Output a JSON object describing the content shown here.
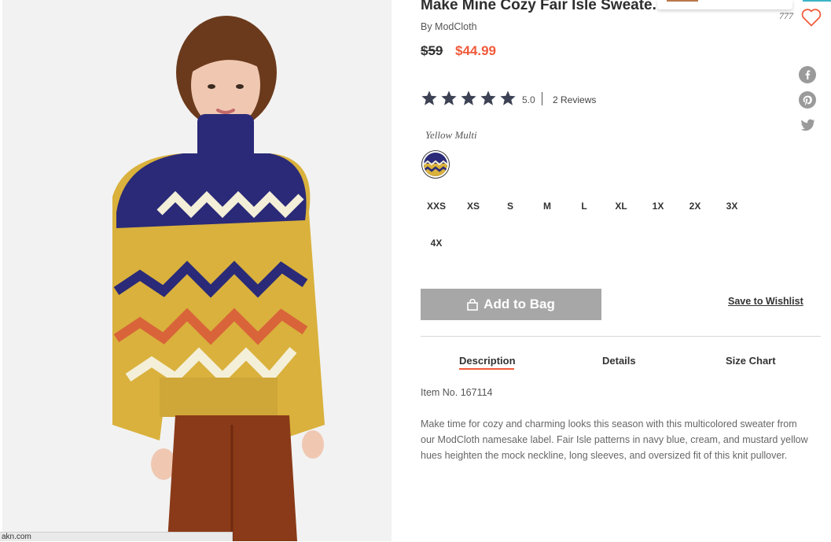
{
  "product": {
    "title": "Make Mine Cozy Fair Isle Sweate.",
    "brand": "By ModCloth",
    "price_original": "$59",
    "price_sale": "$44.99",
    "rating_value": "5.0",
    "rating": 5,
    "rating_max": 5,
    "reviews_label": "2 Reviews",
    "wishlist_count": "777",
    "color_name": "Yellow Multi",
    "sizes": [
      "XXS",
      "XS",
      "S",
      "M",
      "L",
      "XL",
      "1X",
      "2X",
      "3X",
      "4X"
    ]
  },
  "actions": {
    "add_to_bag": "Add to Bag",
    "save_to_wishlist": "Save to Wishlist"
  },
  "tabs": {
    "description": "Description",
    "details": "Details",
    "size_chart": "Size Chart",
    "active": "description"
  },
  "content": {
    "item_no": "Item No. 167114",
    "description": "Make time for cozy and charming looks this season with this multicolored sweater from our ModCloth namesake label. Fair Isle patterns in navy blue, cream, and mustard yellow hues heighten the mock neckline, long sleeves, and oversized fit of this knit pullover."
  },
  "status_bar": {
    "url_fragment": "akn.com"
  },
  "icons": {
    "heart": "heart-icon",
    "facebook": "facebook-icon",
    "pinterest": "pinterest-icon",
    "twitter": "twitter-icon",
    "star": "star-icon",
    "bag": "bag-icon"
  },
  "colors": {
    "accent_sale": "#f05a3a",
    "star": "#3c4254",
    "button_disabled": "#a7a7a7",
    "sweater_navy": "#2a2a78",
    "sweater_mustard": "#d9b13c",
    "sweater_rust": "#d9643a",
    "sweater_cream": "#f4efd8",
    "pants_rust": "#8a3a18"
  }
}
